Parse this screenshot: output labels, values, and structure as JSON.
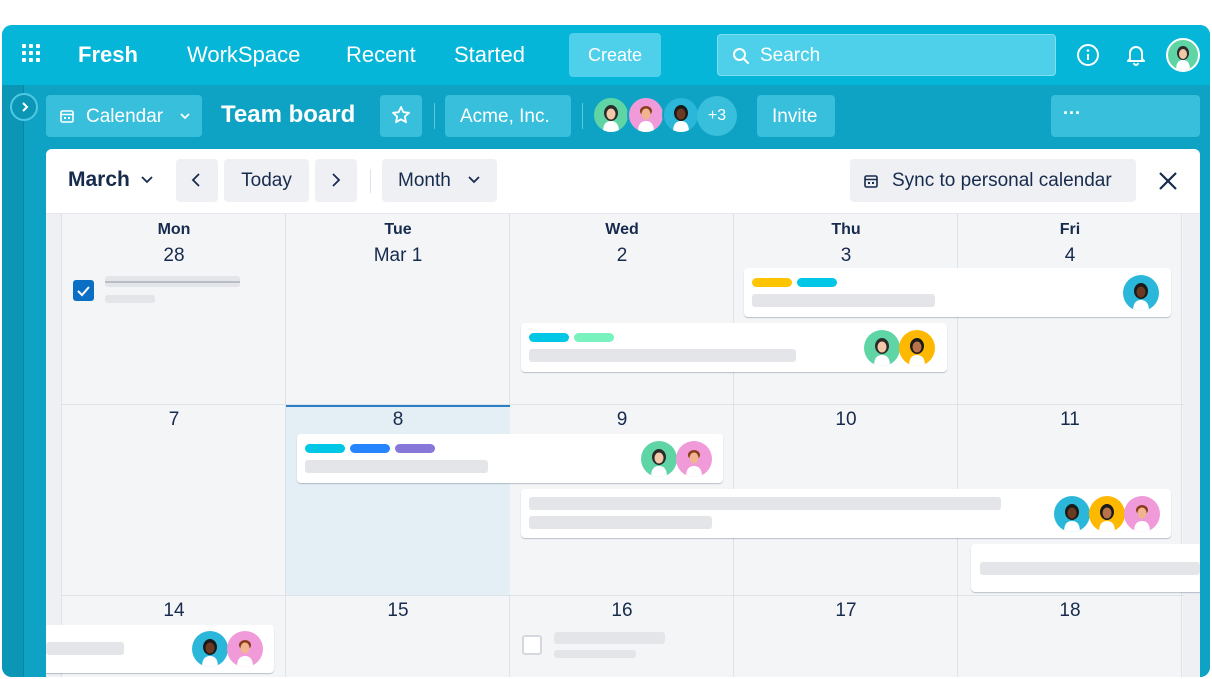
{
  "nav": {
    "brand": "Fresh",
    "items": [
      "WorkSpace",
      "Recent",
      "Started"
    ],
    "create_label": "Create",
    "search_placeholder": "Search"
  },
  "board": {
    "view_label": "Calendar",
    "title": "Team board",
    "workspace_label": "Acme, Inc.",
    "member_overflow": "+3",
    "invite_label": "Invite",
    "more_label": "···"
  },
  "calendar": {
    "month_label": "March",
    "today_label": "Today",
    "view_mode": "Month",
    "sync_label": "Sync to personal calendar",
    "days": [
      {
        "name": "Mon",
        "date": "28"
      },
      {
        "name": "Tue",
        "date": "Mar 1"
      },
      {
        "name": "Wed",
        "date": "2"
      },
      {
        "name": "Thu",
        "date": "3"
      },
      {
        "name": "Fri",
        "date": "4"
      }
    ],
    "week2": [
      "7",
      "8",
      "9",
      "10",
      "11"
    ],
    "week3": [
      "14",
      "15",
      "16",
      "17",
      "18"
    ]
  },
  "colors": {
    "nav_bg": "#05b6d8",
    "board_bg": "#0ea3c4",
    "label_yellow": "#ffc400",
    "label_cyan": "#00c7e6",
    "label_green": "#79f2c0",
    "label_blue": "#2684ff",
    "label_purple": "#8777d9",
    "today_bg": "#e4eff5"
  }
}
